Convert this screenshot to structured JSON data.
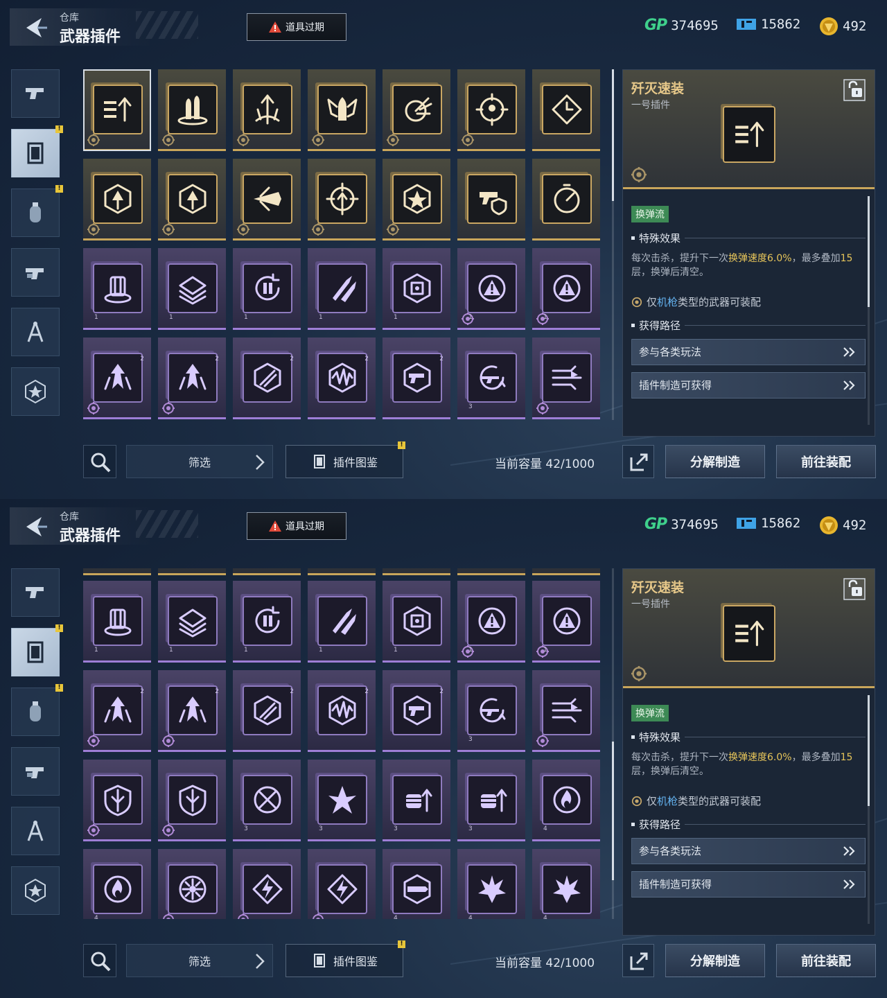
{
  "header": {
    "breadcrumb": "仓库",
    "title": "武器插件",
    "alert_label": "道具过期",
    "currencies": [
      {
        "icon": "gp-icon",
        "label": "GP",
        "value": "374695"
      },
      {
        "icon": "ticket-icon",
        "value": "15862"
      },
      {
        "icon": "coin-icon",
        "value": "492"
      }
    ]
  },
  "sidebar": {
    "items": [
      {
        "name": "weapon",
        "icon": "pistol-icon",
        "badge": false,
        "active": false
      },
      {
        "name": "plugin",
        "icon": "plugin-card-icon",
        "badge": true,
        "active": true
      },
      {
        "name": "consumable",
        "icon": "grenade-icon",
        "badge": true,
        "active": false
      },
      {
        "name": "attachment",
        "icon": "gun-part-icon",
        "badge": false,
        "active": false
      },
      {
        "name": "blueprint",
        "icon": "compass-icon",
        "badge": false,
        "active": false
      },
      {
        "name": "badge",
        "icon": "star-badge-icon",
        "badge": false,
        "active": false
      }
    ],
    "badge_text": "!"
  },
  "toolbar": {
    "filter_label": "筛选",
    "codex_label": "插件图鉴",
    "codex_badge": "!",
    "capacity_label": "当前容量 42/1000",
    "decompose_label": "分解制造",
    "equip_label": "前往装配"
  },
  "grid": {
    "screen1_rows": [
      [
        {
          "icon": "ammo-up-icon",
          "tier": "gold",
          "mark": true,
          "selected": true
        },
        {
          "icon": "bullets-icon",
          "tier": "gold",
          "mark": true
        },
        {
          "icon": "triple-arrow-icon",
          "tier": "gold",
          "mark": true
        },
        {
          "icon": "winged-bullet-icon",
          "tier": "gold",
          "mark": true
        },
        {
          "icon": "burst-shot-icon",
          "tier": "gold",
          "mark": true
        },
        {
          "icon": "crosshair-icon",
          "tier": "gold",
          "mark": true
        },
        {
          "icon": "diamond-clock-icon",
          "tier": "gold",
          "mark": false
        }
      ],
      [
        {
          "icon": "hex-arrow-icon",
          "tier": "gold",
          "mark": true
        },
        {
          "icon": "hex-arrow-split-icon",
          "tier": "gold",
          "mark": true
        },
        {
          "icon": "jet-icon",
          "tier": "gold",
          "mark": true
        },
        {
          "icon": "target-up-icon",
          "tier": "gold",
          "mark": true
        },
        {
          "icon": "star-hex-icon",
          "tier": "gold",
          "mark": true
        },
        {
          "icon": "gun-shield-icon",
          "tier": "gold",
          "mark": false
        },
        {
          "icon": "speed-dial-icon",
          "tier": "gold",
          "mark": false
        }
      ],
      [
        {
          "icon": "cylinder-icon",
          "tier": "purple",
          "mark": false,
          "lvl_b": "1"
        },
        {
          "icon": "stacked-plates-icon",
          "tier": "purple",
          "mark": false,
          "lvl_b": "1"
        },
        {
          "icon": "reload-cycle-icon",
          "tier": "purple",
          "mark": false,
          "lvl_b": "1"
        },
        {
          "icon": "twin-rocket-icon",
          "tier": "purple",
          "mark": false,
          "lvl_b": "1"
        },
        {
          "icon": "hex-core-icon",
          "tier": "purple",
          "mark": false,
          "lvl_b": "1"
        },
        {
          "icon": "warning-cycle-icon",
          "tier": "purple",
          "mark": true,
          "lvl_b": "1"
        },
        {
          "icon": "warning-cycle-icon",
          "tier": "purple",
          "mark": true,
          "lvl_b": "1"
        }
      ],
      [
        {
          "icon": "spiky-arrow-icon",
          "tier": "purple",
          "mark": true,
          "lvl": "2"
        },
        {
          "icon": "spiky-arrow-icon",
          "tier": "purple",
          "mark": true,
          "lvl": "2"
        },
        {
          "icon": "slash-hex-icon",
          "tier": "purple",
          "mark": false,
          "lvl": "2"
        },
        {
          "icon": "wave-hex-icon",
          "tier": "purple",
          "mark": false,
          "lvl": "2"
        },
        {
          "icon": "gun-hex-icon",
          "tier": "purple",
          "mark": false,
          "lvl": "2"
        },
        {
          "icon": "rifle-cycle-icon",
          "tier": "purple",
          "mark": false,
          "lvl_b": "3"
        },
        {
          "icon": "triple-dash-icon",
          "tier": "purple",
          "mark": true
        }
      ]
    ],
    "screen2_rows": [
      [
        {
          "icon": "cylinder-icon",
          "tier": "purple",
          "mark": false,
          "lvl_b": "1"
        },
        {
          "icon": "stacked-plates-icon",
          "tier": "purple",
          "mark": false,
          "lvl_b": "1"
        },
        {
          "icon": "reload-cycle-icon",
          "tier": "purple",
          "mark": false,
          "lvl_b": "1"
        },
        {
          "icon": "twin-rocket-icon",
          "tier": "purple",
          "mark": false,
          "lvl_b": "1"
        },
        {
          "icon": "hex-core-icon",
          "tier": "purple",
          "mark": false,
          "lvl_b": "1"
        },
        {
          "icon": "warning-cycle-icon",
          "tier": "purple",
          "mark": true,
          "lvl_b": "1"
        },
        {
          "icon": "warning-cycle-icon",
          "tier": "purple",
          "mark": true,
          "lvl_b": "1"
        }
      ],
      [
        {
          "icon": "spiky-arrow-icon",
          "tier": "purple",
          "mark": true,
          "lvl": "2"
        },
        {
          "icon": "spiky-arrow-icon",
          "tier": "purple",
          "mark": true,
          "lvl": "2"
        },
        {
          "icon": "slash-hex-icon",
          "tier": "purple",
          "mark": false,
          "lvl": "2"
        },
        {
          "icon": "wave-hex-icon",
          "tier": "purple",
          "mark": false,
          "lvl": "2"
        },
        {
          "icon": "gun-hex-icon",
          "tier": "purple",
          "mark": false,
          "lvl": "2"
        },
        {
          "icon": "rifle-cycle-icon",
          "tier": "purple",
          "mark": false,
          "lvl_b": "3"
        },
        {
          "icon": "triple-dash-icon",
          "tier": "purple",
          "mark": true
        }
      ],
      [
        {
          "icon": "split-shield-icon",
          "tier": "purple",
          "mark": true
        },
        {
          "icon": "split-shield-icon",
          "tier": "purple",
          "mark": true
        },
        {
          "icon": "cross-bullet-icon",
          "tier": "purple",
          "mark": false,
          "lvl_b": "3"
        },
        {
          "icon": "shard-burst-icon",
          "tier": "purple",
          "mark": false,
          "lvl_b": "3"
        },
        {
          "icon": "fist-up-icon",
          "tier": "purple",
          "mark": false,
          "lvl_b": "3"
        },
        {
          "icon": "fist-up-icon",
          "tier": "purple",
          "mark": false,
          "lvl_b": "3"
        },
        {
          "icon": "flame-shield-icon",
          "tier": "purple",
          "mark": false,
          "lvl_b": "4"
        }
      ],
      [
        {
          "icon": "flame-shield-icon",
          "tier": "purple",
          "mark": false,
          "lvl_b": "4"
        },
        {
          "icon": "sunflower-icon",
          "tier": "purple",
          "mark": true
        },
        {
          "icon": "lightning-diamond-icon",
          "tier": "purple",
          "mark": true
        },
        {
          "icon": "lightning-diamond-icon",
          "tier": "purple",
          "mark": true
        },
        {
          "icon": "gun-barrel-icon",
          "tier": "purple",
          "mark": false,
          "lvl_b": "4"
        },
        {
          "icon": "explosion-icon",
          "tier": "purple",
          "mark": false,
          "lvl_b": "4"
        },
        {
          "icon": "explosion-icon",
          "tier": "purple",
          "mark": false,
          "lvl_b": "4"
        }
      ]
    ]
  },
  "detail": {
    "name": "歼灭速装",
    "type": "一号插件",
    "tag": "换弹流",
    "effect_title": "特殊效果",
    "desc_parts": [
      "每次击杀，提升下一次",
      "换弹速度6.0%",
      "，最多叠加",
      "15",
      "层，换弹后清空。"
    ],
    "equip_parts": [
      "仅",
      "机枪",
      "类型的武器可装配"
    ],
    "source_title": "获得路径",
    "sources": [
      "参与各类玩法",
      "插件制造可获得"
    ]
  },
  "colors": {
    "gold": "#c9a65b",
    "purple": "#9e7ed6",
    "tag_green": "#3d8a55",
    "highlight_yellow": "#e7c55a",
    "highlight_blue": "#64b3f0",
    "gp_green": "#3fd08c"
  }
}
